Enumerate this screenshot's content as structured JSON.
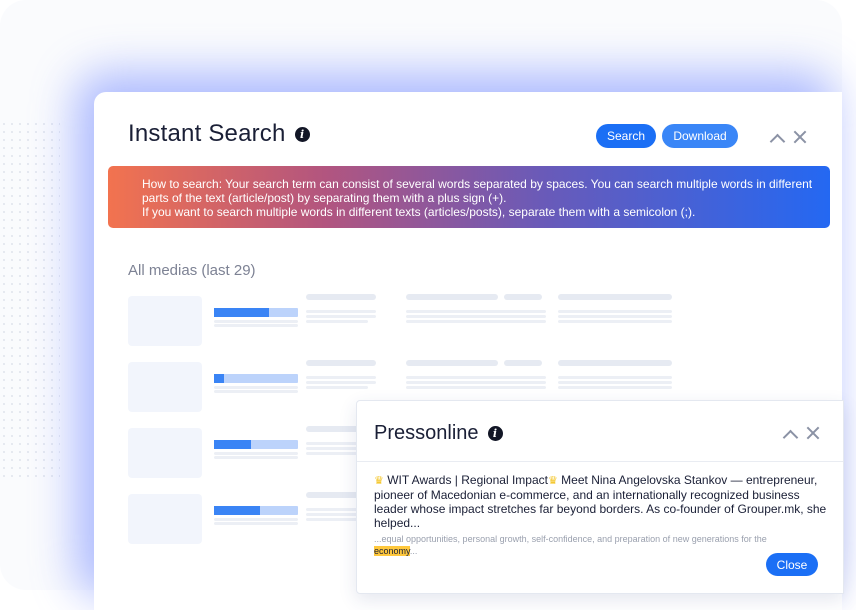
{
  "main_window": {
    "title": "Instant Search",
    "info_icon": "info-icon",
    "buttons": {
      "search": "Search",
      "download": "Download"
    },
    "controls": {
      "collapse": "chevron-up-icon",
      "close": "close-icon"
    },
    "banner": {
      "line1": "How to search: Your search term can consist of several words separated by spaces. You can search multiple words in different parts of the text (article/post) by separating them with a plus sign (+).",
      "line2": "If you want to search multiple words in different texts (articles/posts), separate them with a semicolon (;)."
    },
    "section_label": "All medias (last 29)",
    "skeleton_rows": [
      {
        "progress": 0.65
      },
      {
        "progress": 0.12
      },
      {
        "progress": 0.44
      },
      {
        "progress": 0.55
      }
    ]
  },
  "popup": {
    "title": "Pressonline",
    "info_icon": "info-icon",
    "controls": {
      "collapse": "chevron-up-icon",
      "close": "close-icon"
    },
    "body_part1": "WIT Awards | Regional Impact",
    "body_part2": " Meet Nina Angelovska Stankov — entrepreneur, pioneer of Macedonian e-commerce, and an internationally recognized business leader whose impact stretches far beyond borders. As co-founder of Grouper.mk, she helped...",
    "excerpt_before": "...equal opportunities, personal growth, self-confidence, and preparation of new generations for the ",
    "excerpt_highlight": "economy",
    "excerpt_after": "...",
    "close_label": "Close",
    "crown_icon": "crown-icon"
  },
  "colors": {
    "primary": "#1b6ff5",
    "highlight": "#ffc83d",
    "banner_start": "#f2734f",
    "banner_end": "#2468f2"
  }
}
